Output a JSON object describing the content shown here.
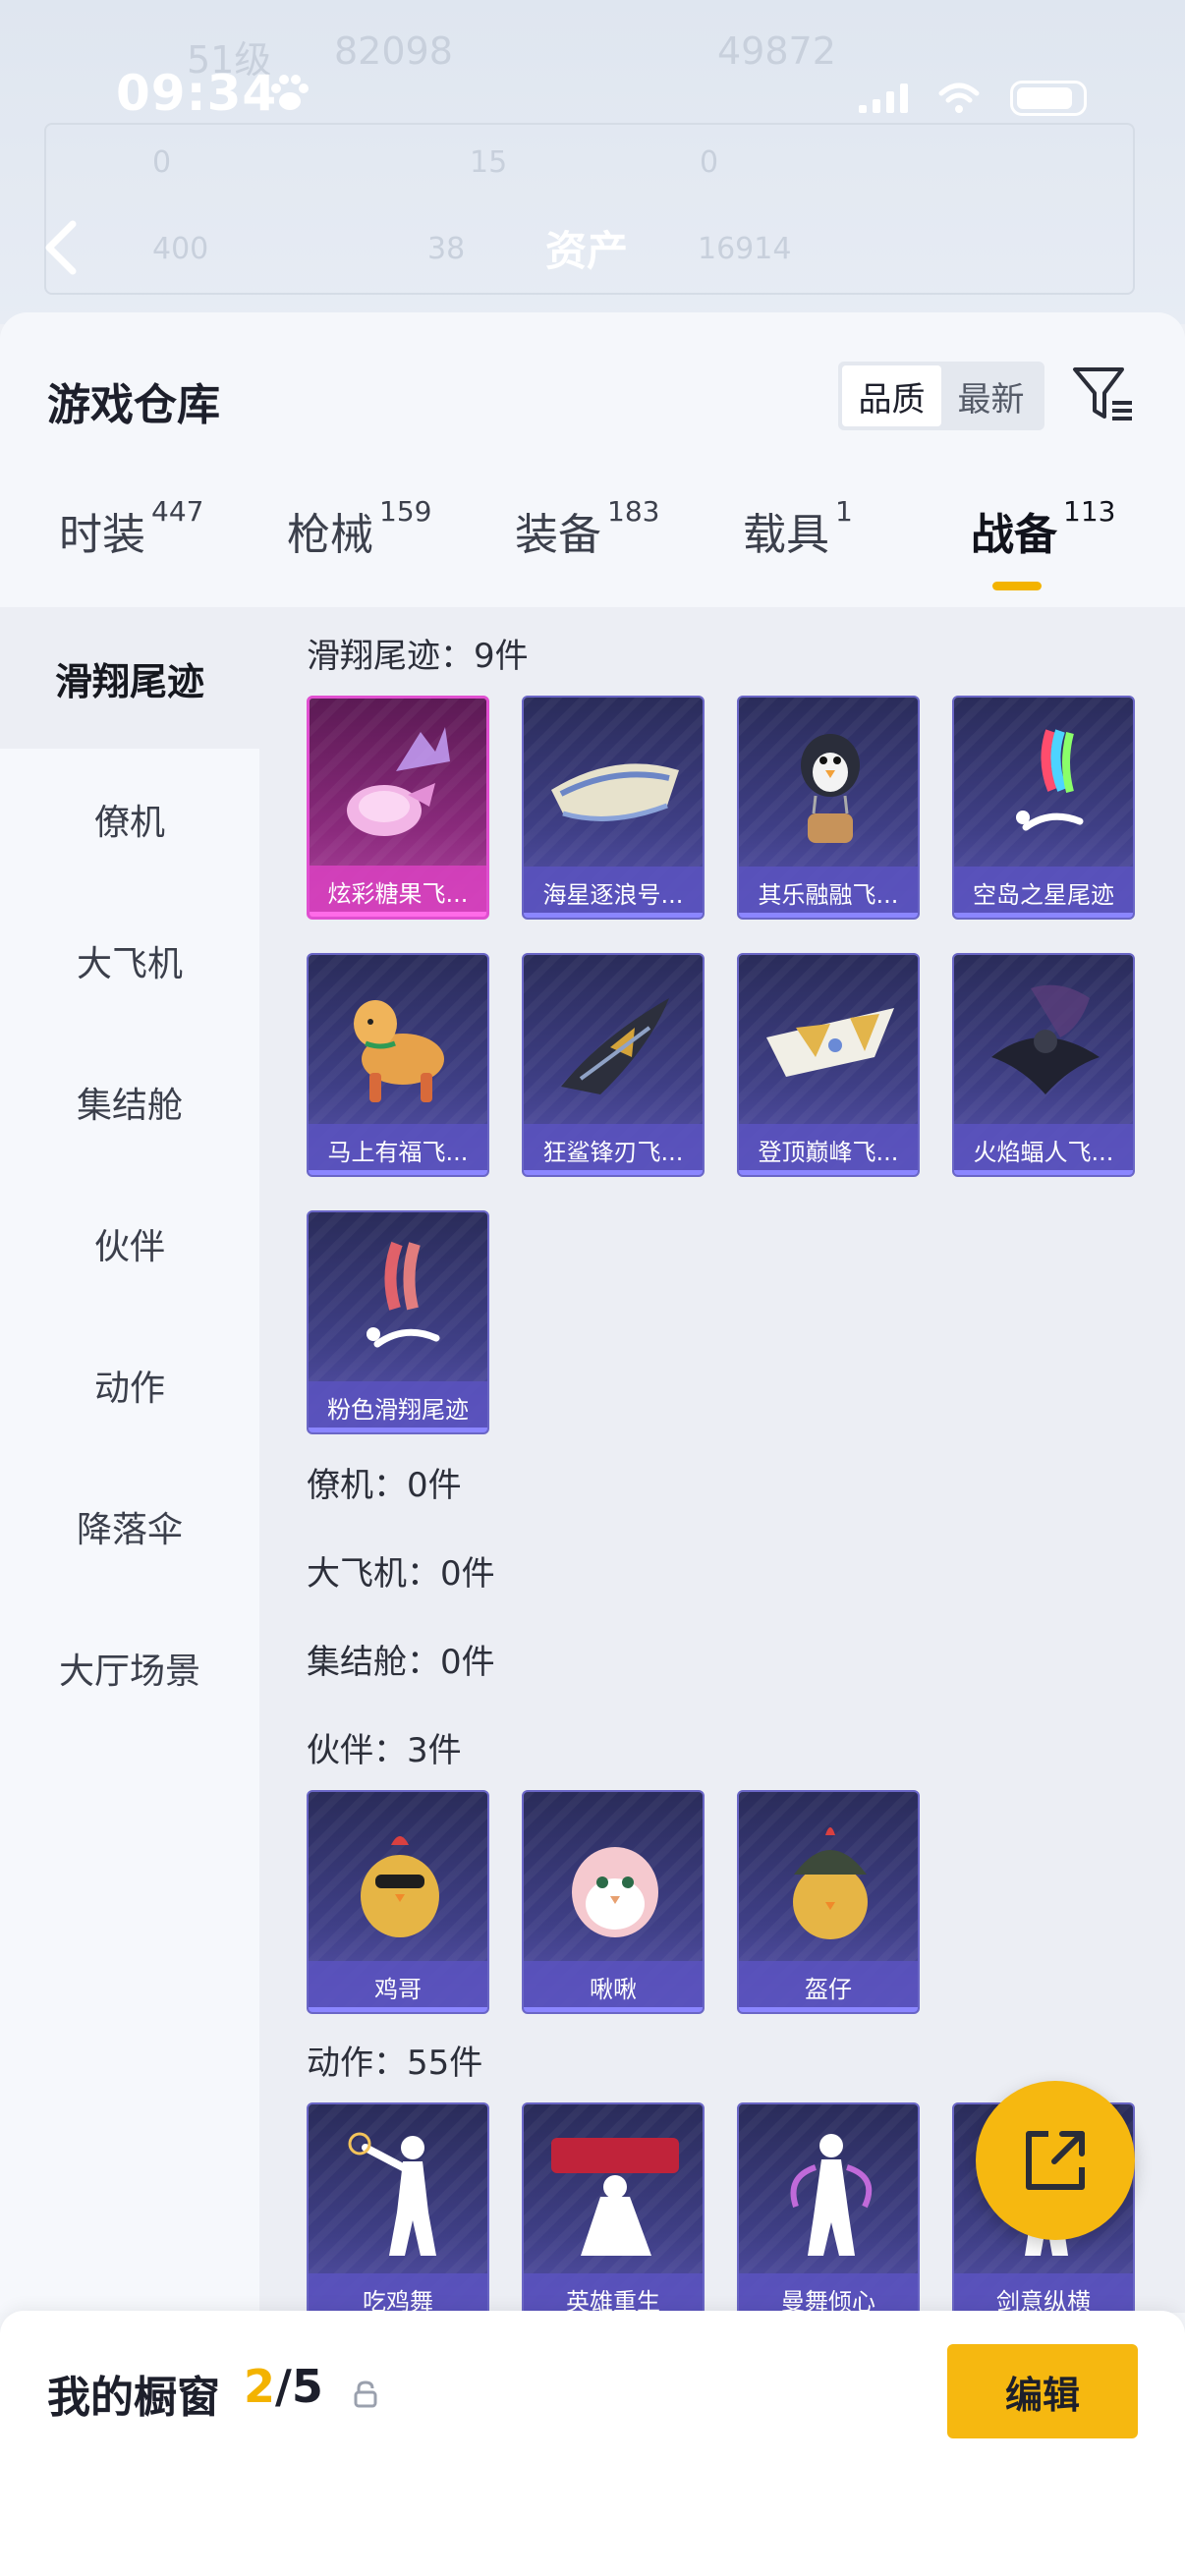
{
  "status_bar": {
    "time": "09:34"
  },
  "background": {
    "title": "资产",
    "level": "51级",
    "score": "82098",
    "score2": "49872",
    "r1": "0",
    "r2": "15",
    "r3": "0",
    "r4": "400",
    "r5": "38",
    "r6": "16914"
  },
  "header": {
    "title": "游戏仓库",
    "sort_options": [
      "品质",
      "最新"
    ],
    "sort_active": "品质"
  },
  "tabs": [
    {
      "label": "时装",
      "count": "447"
    },
    {
      "label": "枪械",
      "count": "159"
    },
    {
      "label": "装备",
      "count": "183"
    },
    {
      "label": "载具",
      "count": "1"
    },
    {
      "label": "战备",
      "count": "113"
    }
  ],
  "active_tab": "战备",
  "sidebar": [
    "滑翔尾迹",
    "僚机",
    "大飞机",
    "集结舱",
    "伙伴",
    "动作",
    "降落伞",
    "大厅场景"
  ],
  "sections": {
    "glide": {
      "title": "滑翔尾迹：9件",
      "items": [
        "炫彩糖果飞...",
        "海星逐浪号...",
        "其乐融融飞...",
        "空岛之星尾迹",
        "马上有福飞...",
        "狂鲨锋刃飞...",
        "登顶巅峰飞...",
        "火焰蝠人飞...",
        "粉色滑翔尾迹"
      ]
    },
    "wingman": {
      "title": "僚机：0件"
    },
    "plane": {
      "title": "大飞机：0件"
    },
    "pod": {
      "title": "集结舱：0件"
    },
    "partner": {
      "title": "伙伴：3件",
      "items": [
        "鸡哥",
        "啾啾",
        "盔仔"
      ]
    },
    "emote": {
      "title": "动作：55件",
      "items": [
        "吃鸡舞",
        "英雄重生",
        "曼舞倾心",
        "剑意纵横"
      ]
    }
  },
  "showcase": {
    "title": "我的橱窗",
    "current": "2",
    "total": "/5",
    "edit": "编辑"
  },
  "colors": {
    "accent": "#f6b810",
    "card": "#3f3f86",
    "pink_card": "#8a2a7c"
  }
}
